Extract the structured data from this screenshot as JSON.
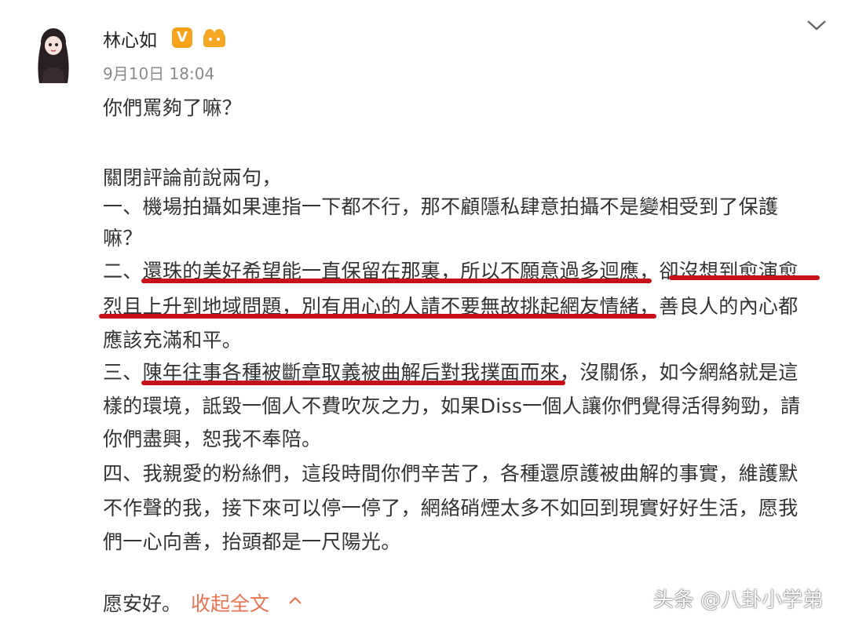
{
  "post": {
    "author": "林心如",
    "vip_badge": "V",
    "timestamp": "9月10日 18:04",
    "lines": [
      "你們罵夠了嘛？",
      "",
      "關閉評論前說兩句，",
      "一、機場拍攝如果連指一下都不行，那不顧隱私肆意拍攝不是變相受到了保護",
      "嘛？",
      "二、還珠的美好希望能一直保留在那裏，所以不願意過多迴應，卻沒想到愈演愈",
      "烈且上升到地域問題，別有用心的人請不要無故挑起網友情緒，善良人的內心都",
      "應該充滿和平。",
      "三、陳年往事各種被斷章取義被曲解后對我撲面而來，沒關係，如今網絡就是這",
      "樣的環境，詆毀一個人不費吹灰之力，如果Diss一個人讓你們覺得活得夠勁，請",
      "你們盡興，恕我不奉陪。",
      "四、我親愛的粉絲們，這段時間你們辛苦了，各種還原護被曲解的事實，維護默",
      "不作聲的我，接下來可以停一停了，網絡硝煙太多不如回到現實好好生活，愿我",
      "們一心向善，抬頭都是一尺陽光。"
    ],
    "closing": "愿安好。",
    "collapse_label": "收起全文"
  },
  "icons": {
    "menu": "chevron-down-icon",
    "collapse": "chevron-up-icon",
    "avatar": "avatar",
    "level": "level-badge-icon"
  },
  "colors": {
    "highlight": "#c8101a",
    "link": "#eb7350",
    "vip": "#f7a21a"
  },
  "watermark": "头条 @八卦小学弟"
}
